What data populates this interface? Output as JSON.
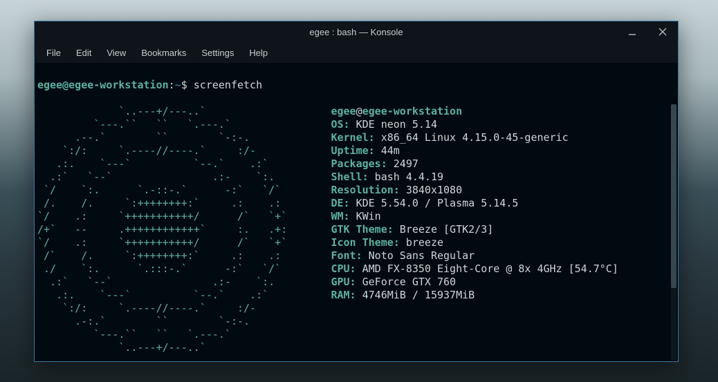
{
  "window": {
    "title": "egee : bash — Konsole"
  },
  "menubar": [
    "File",
    "Edit",
    "View",
    "Bookmarks",
    "Settings",
    "Help"
  ],
  "prompt": {
    "user": "egee@egee-workstation",
    "sep": ":",
    "path": "~",
    "sigil": "$",
    "command": "screenfetch"
  },
  "ascii": [
    "             `..---+/---..`",
    "         `---.``   ``   `.---.`",
    "      .--.`        ``        `-:-.",
    "    `:/:     `.----//----.`     :/-",
    "   .:.    `---`          `--.`    .:`",
    "  .:`   `--`                .:-    `:.",
    " `/    `:.      `.-::-.`      -:`   `/`",
    " /.    /.     `:++++++++:`     .:    .:",
    "`/    .:     `+++++++++++/      /`   `+`",
    "/+`   --     .++++++++++++`     :.   .+:",
    "`/    .:     `+++++++++++/      /`   `+`",
    " /`    /.     `:++++++++:`     .:    .:",
    " ./    `:.      `.:::-.`      -:`   `/`",
    "  .:`   `--`                .:-    `:.",
    "   .:.    `---`          `--.`    .:`",
    "    `:/:     `.----//----.`     :/-",
    "      .-:.`        ``        `-:-.",
    "         `---.``   ``   `.---.`",
    "             `..---+/---..`"
  ],
  "info": {
    "header_user": "egee",
    "header_at": "@",
    "header_host": "egee-workstation",
    "lines": [
      {
        "label": "OS:",
        "value": " KDE neon 5.14"
      },
      {
        "label": "Kernel:",
        "value": " x86_64 Linux 4.15.0-45-generic"
      },
      {
        "label": "Uptime:",
        "value": " 44m"
      },
      {
        "label": "Packages:",
        "value": " 2497"
      },
      {
        "label": "Shell:",
        "value": " bash 4.4.19"
      },
      {
        "label": "Resolution:",
        "value": " 3840x1080"
      },
      {
        "label": "DE:",
        "value": " KDE 5.54.0 / Plasma 5.14.5"
      },
      {
        "label": "WM:",
        "value": " KWin"
      },
      {
        "label": "GTK Theme:",
        "value": " Breeze [GTK2/3]"
      },
      {
        "label": "Icon Theme:",
        "value": " breeze"
      },
      {
        "label": "Font:",
        "value": " Noto Sans Regular"
      },
      {
        "label": "CPU:",
        "value": " AMD FX-8350 Eight-Core @ 8x 4GHz [54.7°C]"
      },
      {
        "label": "GPU:",
        "value": " GeForce GTX 760"
      },
      {
        "label": "RAM:",
        "value": " 4746MiB / 15937MiB"
      }
    ]
  }
}
